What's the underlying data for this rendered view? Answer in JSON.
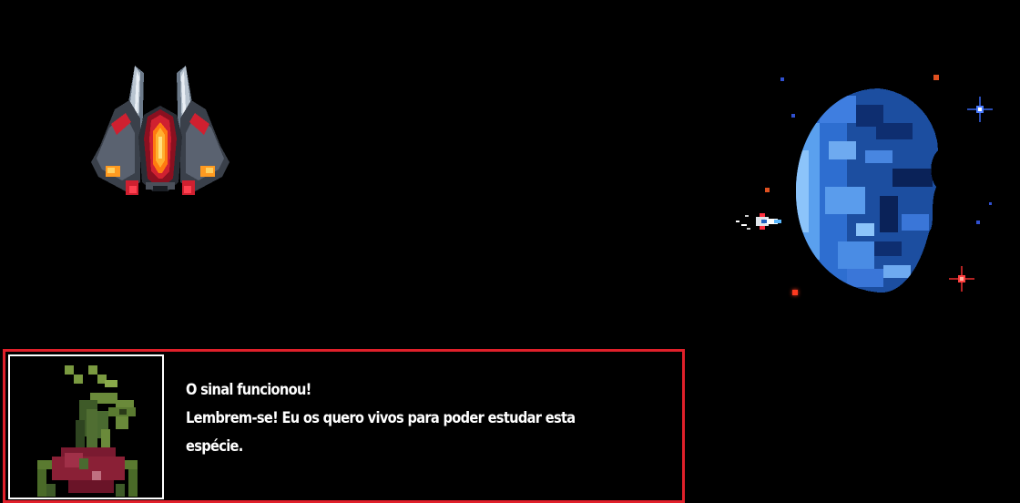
{
  "dialog": {
    "lines": [
      "O sinal funcionou!",
      "Lembrem-se! Eu os quero vivos para poder estudar esta",
      "espécie."
    ],
    "speaker_icon": "alien-plant-portrait-icon"
  },
  "scene": {
    "enemy_icon": "enemy-spaceship-icon",
    "player_icon": "player-spaceship-icon",
    "planet_icon": "earth-planet-icon"
  },
  "colors": {
    "background": "#000000",
    "dialog_border": "#e0202a",
    "portrait_border": "#ffffff",
    "text": "#ffffff"
  }
}
